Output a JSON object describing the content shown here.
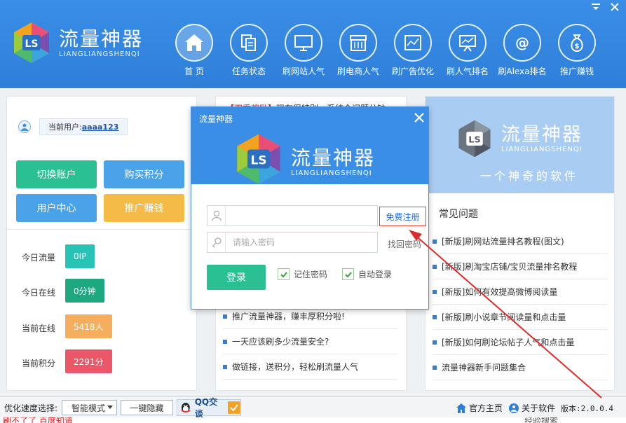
{
  "app": {
    "name_cn": "流量神器",
    "name_en": "LIANGLIANGSHENQI"
  },
  "nav": [
    {
      "label": "首 页",
      "icon": "home-icon"
    },
    {
      "label": "任务状态",
      "icon": "document-icon"
    },
    {
      "label": "刷网站人气",
      "icon": "monitor-icon"
    },
    {
      "label": "刷电商人气",
      "icon": "store-icon"
    },
    {
      "label": "刷广告优化",
      "icon": "ad-chart-icon"
    },
    {
      "label": "刷人气排名",
      "icon": "ranking-board-icon"
    },
    {
      "label": "刷Alexa排名",
      "icon": "at-icon"
    },
    {
      "label": "推广赚钱",
      "icon": "money-bag-icon"
    }
  ],
  "user": {
    "prefix": "当前用户:",
    "name": "aaaa123"
  },
  "buttons": {
    "switch": "切换账户",
    "buy": "购买积分",
    "center": "用户中心",
    "promo": "推广赚钱"
  },
  "stats": [
    {
      "label": "今日流量",
      "value": "0IP",
      "color": "#27c3b7"
    },
    {
      "label": "今日在线",
      "value": "0分钟",
      "color": "#1ea882"
    },
    {
      "label": "当前在线",
      "value": "5418人",
      "color": "#f4ae5e"
    },
    {
      "label": "当前积分",
      "value": "2291分",
      "color": "#ea5768"
    }
  ],
  "middle": {
    "top_red": "【双重奖励】",
    "top_rest": "现有很特别，系统全问题分钟",
    "news": [
      "推广流量神器，赚丰厚积分啦!",
      "一天应该刷多少流量安全?",
      "做链接，送积分，轻松刷流量人气"
    ]
  },
  "right": {
    "slogan": "一个神奇的软件",
    "faq_title": "常见问题",
    "faq": [
      "[新版]刷网站流量排名教程(图文)",
      "[新版]刷淘宝店铺/宝贝流量排名教程",
      "[新版]如何有效提高微博阅读量",
      "[新版]刷小说章节阅读量和点击量",
      "[新版]如何刷论坛帖子人气和点击量",
      "流量神器新手问题集合"
    ]
  },
  "bottom": {
    "speed_label": "优化速度选择:",
    "mode": "智能模式",
    "hide": "一键隐藏",
    "qq": "QQ交谈",
    "homepage": "官方主页",
    "about": "关于软件",
    "version": "版本:2.0.0.4",
    "under_left": "刷不了了  百度知道",
    "under_right": "经验搜索"
  },
  "dialog": {
    "title": "流量神器",
    "username_value": "",
    "password_placeholder": "请输入密码",
    "register": "免费注册",
    "forgot": "找回密码",
    "login": "登录",
    "remember": "记住密码",
    "auto": "自动登录"
  },
  "colors": {
    "header": "#3a8ee6",
    "green": "#2bbf94",
    "blue": "#4aa3e8",
    "yellow": "#f4bb47",
    "annotation_red": "#e02a2a"
  }
}
